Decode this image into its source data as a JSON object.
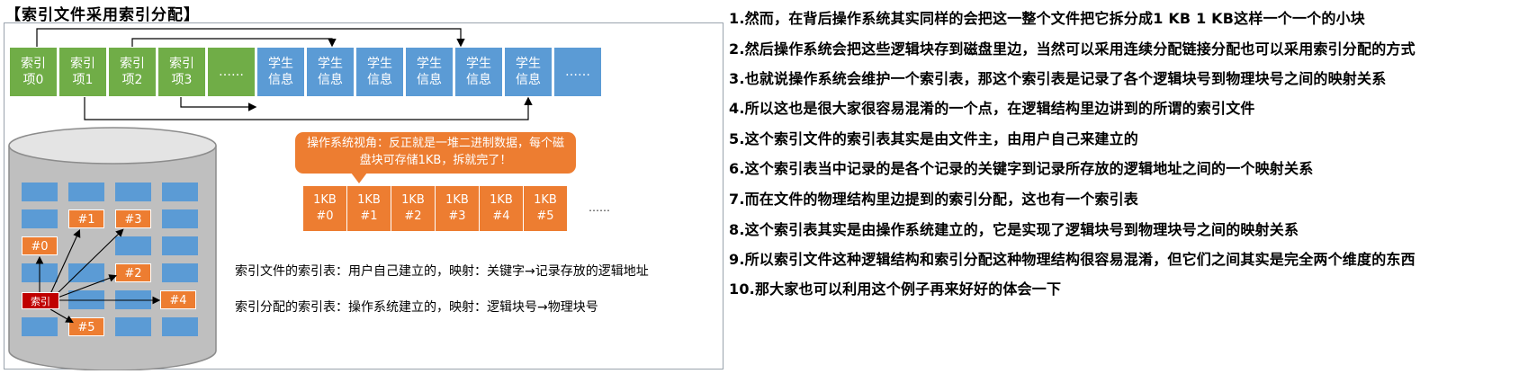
{
  "title": "【索引文件采用索引分配】",
  "top_row": [
    {
      "label": "索引\n项0",
      "color": "green"
    },
    {
      "label": "索引\n项1",
      "color": "green"
    },
    {
      "label": "索引\n项2",
      "color": "green"
    },
    {
      "label": "索引\n项3",
      "color": "green"
    },
    {
      "label": "……",
      "color": "green"
    },
    {
      "label": "学生\n信息",
      "color": "blue"
    },
    {
      "label": "学生\n信息",
      "color": "blue"
    },
    {
      "label": "学生\n信息",
      "color": "blue"
    },
    {
      "label": "学生\n信息",
      "color": "blue"
    },
    {
      "label": "学生\n信息",
      "color": "blue"
    },
    {
      "label": "学生\n信息",
      "color": "blue"
    },
    {
      "label": "……",
      "color": "blue"
    }
  ],
  "bubble_text": "操作系统视角：反正就是一堆二进制数据，每个磁盘块可存储1KB，拆就完了！",
  "kb_blocks": [
    "1KB\n#0",
    "1KB\n#1",
    "1KB\n#2",
    "1KB\n#3",
    "1KB\n#4",
    "1KB\n#5"
  ],
  "kb_more": "……",
  "disk": {
    "index_label": "索引",
    "blocks": [
      "#0",
      "#1",
      "#2",
      "#3",
      "#4",
      "#5"
    ]
  },
  "notes": [
    "索引文件的索引表：用户自己建立的，映射：关键字→记录存放的逻辑地址",
    "索引分配的索引表：操作系统建立的，映射：逻辑块号→物理块号"
  ],
  "lines": [
    "1.然而，在背后操作系统其实同样的会把这一整个文件把它拆分成1 KB 1 KB这样一个一个的小块",
    "2.然后操作系统会把这些逻辑块存到磁盘里边，当然可以采用连续分配链接分配也可以采用索引分配的方式",
    "3.也就说操作系统会维护一个索引表，那这个索引表是记录了各个逻辑块号到物理块号之间的映射关系",
    "4.所以这也是很大家很容易混淆的一个点，在逻辑结构里边讲到的所谓的索引文件",
    "5.这个索引文件的索引表其实是由文件主，由用户自己来建立的",
    "6.这个索引表当中记录的是各个记录的关键字到记录所存放的逻辑地址之间的一个映射关系",
    "7.而在文件的物理结构里边提到的索引分配，这也有一个索引表",
    "8.这个索引表其实是由操作系统建立的，它是实现了逻辑块号到物理块号之间的映射关系",
    "9.所以索引文件这种逻辑结构和索引分配这种物理结构很容易混淆，但它们之间其实是完全两个维度的东西",
    "10.那大家也可以利用这个例子再来好好的体会一下"
  ],
  "colors": {
    "green": "#70ad47",
    "blue": "#5b9bd5",
    "orange": "#ed7d31",
    "red": "#c00000"
  }
}
